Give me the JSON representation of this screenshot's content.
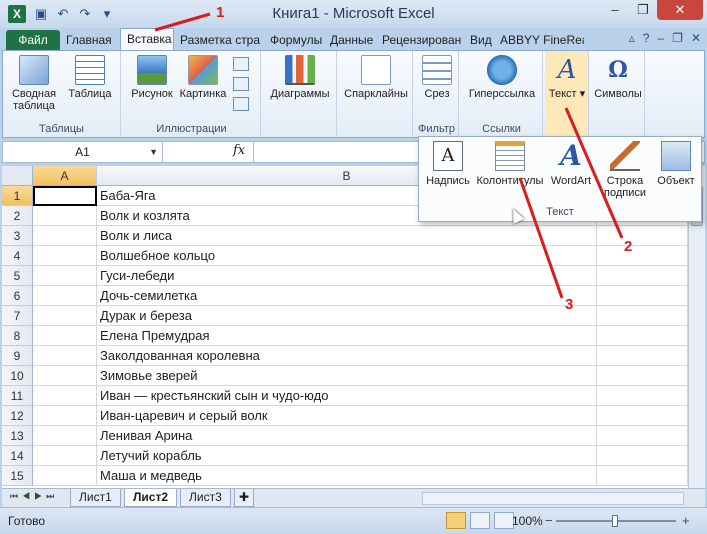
{
  "window": {
    "title": "Книга1 - Microsoft Excel",
    "app_icon": "excel-icon",
    "controls": [
      "minimize",
      "restore",
      "close"
    ]
  },
  "quick_access": [
    "save-icon",
    "undo-icon",
    "redo-icon",
    "customize-icon"
  ],
  "tabs": [
    {
      "label": "Файл"
    },
    {
      "label": "Главная"
    },
    {
      "label": "Вставка"
    },
    {
      "label": "Разметка стра"
    },
    {
      "label": "Формулы"
    },
    {
      "label": "Данные"
    },
    {
      "label": "Рецензирован"
    },
    {
      "label": "Вид"
    },
    {
      "label": "ABBYY FineRea"
    }
  ],
  "ribbon": {
    "groups": [
      {
        "label": "Таблицы",
        "buttons": [
          "Сводная таблица",
          "Таблица"
        ]
      },
      {
        "label": "Иллюстрации",
        "buttons": [
          "Рисунок",
          "Картинка"
        ]
      },
      {
        "label": "",
        "buttons": [
          "Диаграммы"
        ]
      },
      {
        "label": "",
        "buttons": [
          "Спарклайны"
        ]
      },
      {
        "label": "Фильтр",
        "buttons": [
          "Срез"
        ]
      },
      {
        "label": "Ссылки",
        "buttons": [
          "Гиперссылка"
        ]
      },
      {
        "label": "",
        "buttons": [
          "Текст"
        ]
      },
      {
        "label": "",
        "buttons": [
          "Символы"
        ]
      }
    ]
  },
  "text_panel": {
    "label": "Текст",
    "buttons": [
      "Надпись",
      "Колонтитулы",
      "WordArt",
      "Строка подписи",
      "Объект"
    ]
  },
  "formula_bar": {
    "name_box": "A1",
    "fx": "fx",
    "value": ""
  },
  "columns": [
    "A",
    "B"
  ],
  "rows": [
    {
      "n": "1",
      "b": "Баба-Яга"
    },
    {
      "n": "2",
      "b": "Волк и козлята"
    },
    {
      "n": "3",
      "b": "Волк и лиса"
    },
    {
      "n": "4",
      "b": "Волшебное кольцо"
    },
    {
      "n": "5",
      "b": "Гуси-лебеди"
    },
    {
      "n": "6",
      "b": "Дочь-семилетка"
    },
    {
      "n": "7",
      "b": "Дурак и береза"
    },
    {
      "n": "8",
      "b": "Елена Премудрая"
    },
    {
      "n": "9",
      "b": "Заколдованная королевна"
    },
    {
      "n": "10",
      "b": "Зимовье зверей"
    },
    {
      "n": "11",
      "b": "Иван — крестьянский сын и чудо-юдо"
    },
    {
      "n": "12",
      "b": "Иван-царевич и серый волк"
    },
    {
      "n": "13",
      "b": "Ленивая Арина"
    },
    {
      "n": "14",
      "b": "Летучий корабль"
    },
    {
      "n": "15",
      "b": "Маша и медведь"
    }
  ],
  "sheets": [
    {
      "label": "Лист1"
    },
    {
      "label": "Лист2"
    },
    {
      "label": "Лист3"
    }
  ],
  "status": {
    "ready": "Готово",
    "zoom": "100%"
  },
  "annotations": [
    "1",
    "2",
    "3"
  ],
  "colors": {
    "file_tab": "#1f7244",
    "annotation": "#d91c1c",
    "selection_header": "#f1c15f"
  }
}
